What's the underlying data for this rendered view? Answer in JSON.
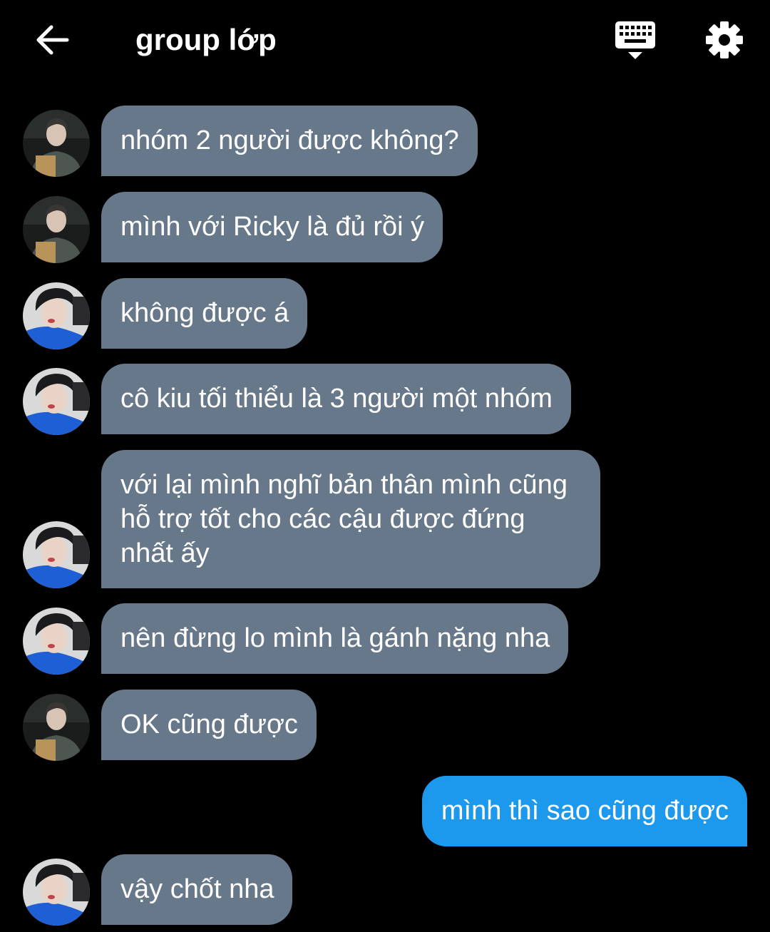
{
  "header": {
    "title": "group lớp",
    "back_icon": "arrow-left-icon",
    "keyboard_icon": "keyboard-icon",
    "settings_icon": "gear-icon"
  },
  "colors": {
    "background": "#000000",
    "incoming_bubble": "#66788a",
    "outgoing_bubble": "#1c98ec",
    "text": "#ffffff"
  },
  "messages": [
    {
      "sender": "friend_a",
      "text": "nhóm 2 người được không?"
    },
    {
      "sender": "friend_a",
      "text": "mình với Ricky là đủ rồi ý"
    },
    {
      "sender": "friend_b",
      "text": "không được á"
    },
    {
      "sender": "friend_b",
      "text": "cô kiu tối thiểu là 3 người một nhóm"
    },
    {
      "sender": "friend_b",
      "text": "với lại mình nghĩ bản thân mình cũng hỗ trợ tốt cho các cậu được đứng nhất ấy"
    },
    {
      "sender": "friend_b",
      "text": "nên đừng lo mình là gánh nặng nha"
    },
    {
      "sender": "friend_a",
      "text": "OK cũng được"
    },
    {
      "sender": "me",
      "text": "mình thì sao cũng được"
    },
    {
      "sender": "friend_b",
      "text": "vậy chốt nha"
    }
  ]
}
